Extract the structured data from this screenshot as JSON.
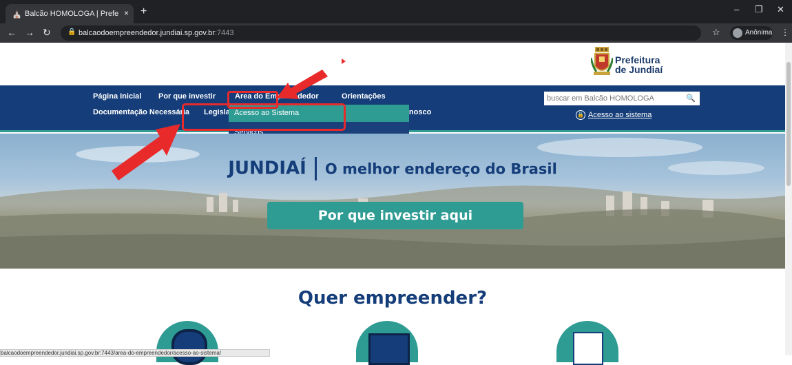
{
  "browser": {
    "tab_title": "Balcão HOMOLOGA | Prefeitura d...",
    "tab_close": "×",
    "new_tab": "+",
    "url_host": "balcaodoempreendedor.jundiai.sp.gov.br",
    "url_port": ":7443",
    "profile_label": "Anônima"
  },
  "header": {
    "logo_line1": "Prefeitura",
    "logo_line2": "de Jundiaí"
  },
  "nav": {
    "row1": [
      "Página Inicial",
      "Por que investir",
      "Área do Empreendedor",
      "Orientações"
    ],
    "row2": [
      "Documentação Necessária",
      "Legislação",
      "Fale conosco"
    ],
    "search_placeholder": "buscar em Balcão HOMOLOGA",
    "access_link": "Acesso ao sistema"
  },
  "dropdown": {
    "items": [
      "Acesso ao Sistema",
      "Serviços"
    ]
  },
  "hero": {
    "title": "JUNDIAÍ",
    "subtitle": "O melhor endereço do Brasil",
    "cta": "Por que investir aqui"
  },
  "section": {
    "title": "Quer empreender?"
  },
  "status_url": "balcaodoempreendedor.jundiai.sp.gov.br:7443/area-do-empreendedor/acesso-ao-sistema/",
  "colors": {
    "navy": "#143d79",
    "teal": "#2f9c94",
    "highlight_red": "#e82a2a"
  }
}
